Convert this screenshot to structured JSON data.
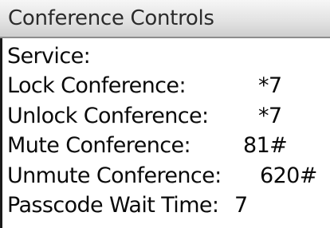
{
  "header": {
    "title": "Conference Controls"
  },
  "settings": {
    "service_label": "Service:",
    "items": [
      {
        "label": "Lock Conference:",
        "value": "*7"
      },
      {
        "label": "Unlock Conference:",
        "value": "*7"
      },
      {
        "label": "Mute Conference:",
        "value": "81#"
      },
      {
        "label": "Unmute Conference:",
        "value": "620#"
      },
      {
        "label": "Passcode Wait Time:",
        "value": "7"
      }
    ]
  },
  "colors": {
    "background": "#ffffff",
    "text": "#0a0a0a",
    "title_bar": "#e3e3e3"
  }
}
